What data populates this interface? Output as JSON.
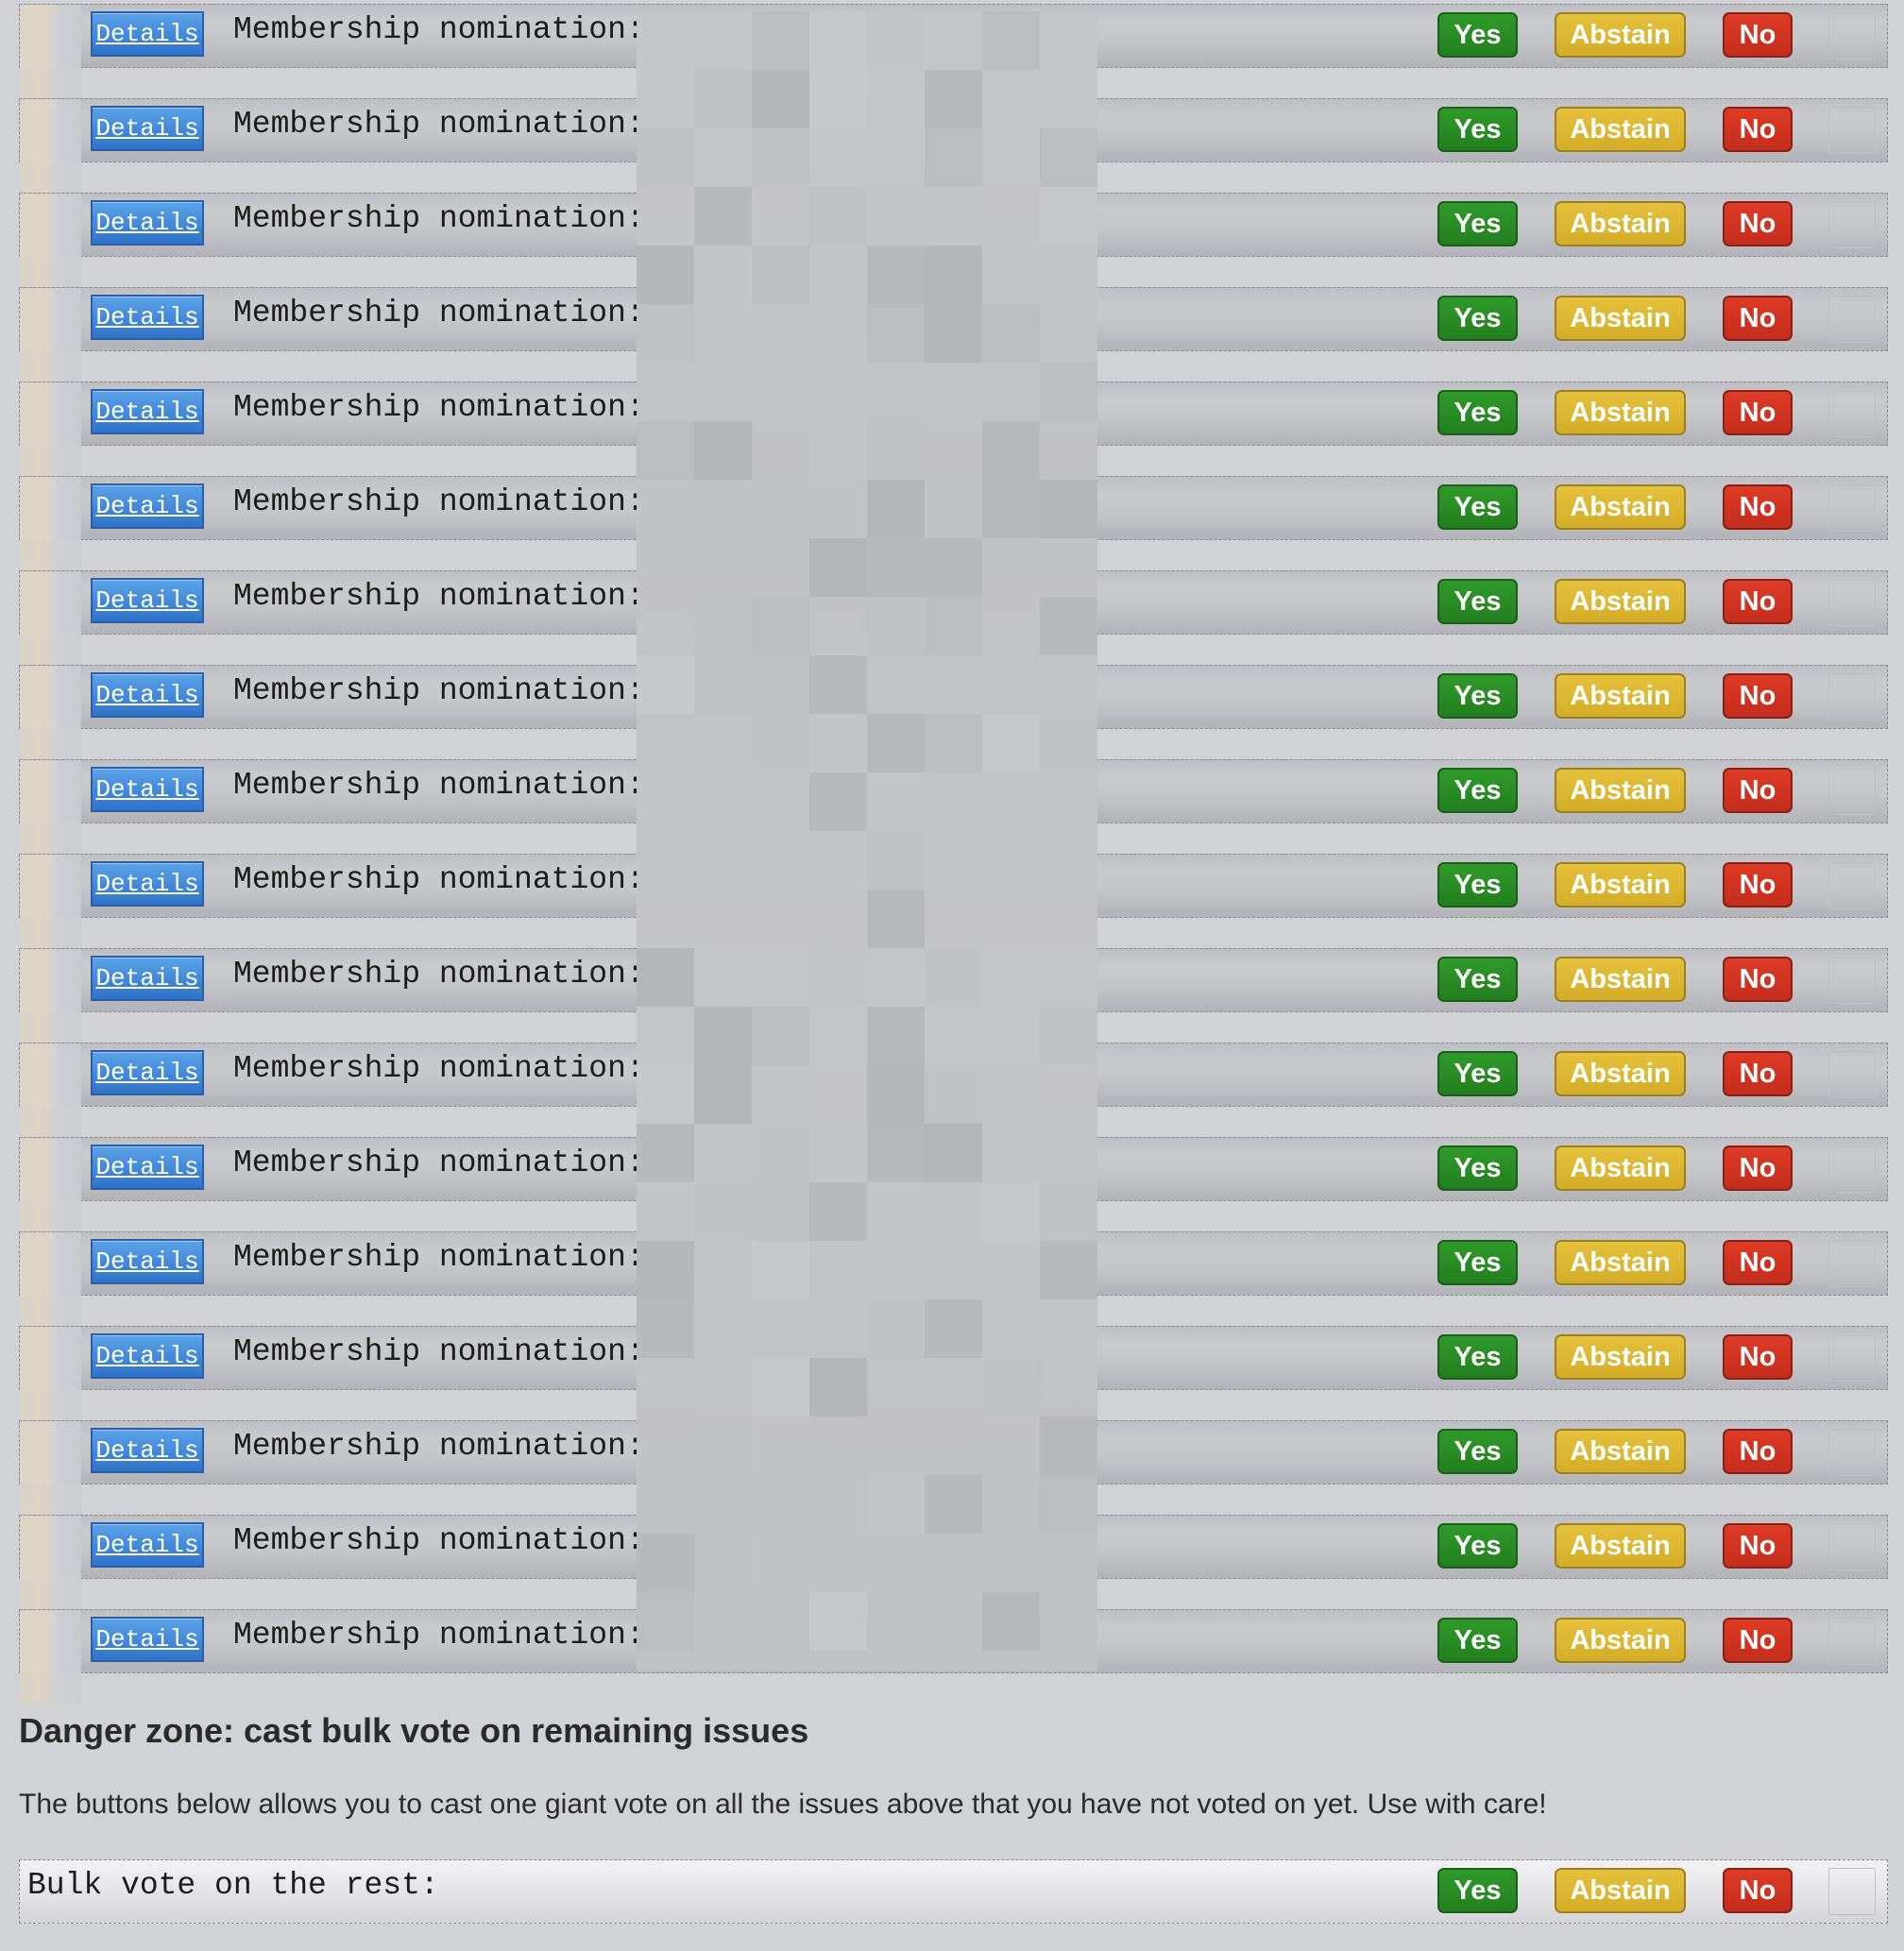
{
  "nominations": [
    {
      "details_label": "Details",
      "title": "Membership nomination:",
      "yes_label": "Yes",
      "abstain_label": "Abstain",
      "no_label": "No"
    },
    {
      "details_label": "Details",
      "title": "Membership nomination:",
      "yes_label": "Yes",
      "abstain_label": "Abstain",
      "no_label": "No"
    },
    {
      "details_label": "Details",
      "title": "Membership nomination:",
      "yes_label": "Yes",
      "abstain_label": "Abstain",
      "no_label": "No"
    },
    {
      "details_label": "Details",
      "title": "Membership nomination:",
      "yes_label": "Yes",
      "abstain_label": "Abstain",
      "no_label": "No"
    },
    {
      "details_label": "Details",
      "title": "Membership nomination:",
      "yes_label": "Yes",
      "abstain_label": "Abstain",
      "no_label": "No"
    },
    {
      "details_label": "Details",
      "title": "Membership nomination:",
      "yes_label": "Yes",
      "abstain_label": "Abstain",
      "no_label": "No"
    },
    {
      "details_label": "Details",
      "title": "Membership nomination:",
      "yes_label": "Yes",
      "abstain_label": "Abstain",
      "no_label": "No"
    },
    {
      "details_label": "Details",
      "title": "Membership nomination:",
      "yes_label": "Yes",
      "abstain_label": "Abstain",
      "no_label": "No"
    },
    {
      "details_label": "Details",
      "title": "Membership nomination:",
      "yes_label": "Yes",
      "abstain_label": "Abstain",
      "no_label": "No"
    },
    {
      "details_label": "Details",
      "title": "Membership nomination:",
      "yes_label": "Yes",
      "abstain_label": "Abstain",
      "no_label": "No"
    },
    {
      "details_label": "Details",
      "title": "Membership nomination:",
      "yes_label": "Yes",
      "abstain_label": "Abstain",
      "no_label": "No"
    },
    {
      "details_label": "Details",
      "title": "Membership nomination:",
      "yes_label": "Yes",
      "abstain_label": "Abstain",
      "no_label": "No"
    },
    {
      "details_label": "Details",
      "title": "Membership nomination:",
      "yes_label": "Yes",
      "abstain_label": "Abstain",
      "no_label": "No"
    },
    {
      "details_label": "Details",
      "title": "Membership nomination:",
      "yes_label": "Yes",
      "abstain_label": "Abstain",
      "no_label": "No"
    },
    {
      "details_label": "Details",
      "title": "Membership nomination:",
      "yes_label": "Yes",
      "abstain_label": "Abstain",
      "no_label": "No"
    },
    {
      "details_label": "Details",
      "title": "Membership nomination:",
      "yes_label": "Yes",
      "abstain_label": "Abstain",
      "no_label": "No"
    },
    {
      "details_label": "Details",
      "title": "Membership nomination:",
      "yes_label": "Yes",
      "abstain_label": "Abstain",
      "no_label": "No"
    },
    {
      "details_label": "Details",
      "title": "Membership nomination:",
      "yes_label": "Yes",
      "abstain_label": "Abstain",
      "no_label": "No"
    }
  ],
  "danger_zone": {
    "title": "Danger zone: cast bulk vote on remaining issues",
    "description": "The buttons below allows you to cast one giant vote on all the issues above that you have not voted on yet. Use with care!"
  },
  "bulk_vote": {
    "label": "Bulk vote on the rest:",
    "yes_label": "Yes",
    "abstain_label": "Abstain",
    "no_label": "No"
  },
  "colors": {
    "yes": "#2f9a2a",
    "abstain": "#e5c23b",
    "no": "#dd3b26",
    "details": "#3f86d8"
  }
}
